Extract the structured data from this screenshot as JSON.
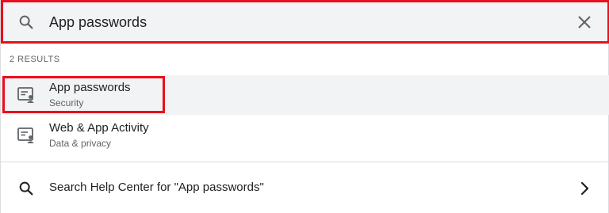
{
  "search": {
    "value": "App passwords",
    "search_icon": "search-icon",
    "clear_icon": "close-icon"
  },
  "results": {
    "count_label": "2 RESULTS",
    "items": [
      {
        "title": "App passwords",
        "subtitle": "Security",
        "icon": "account-settings-icon"
      },
      {
        "title": "Web & App Activity",
        "subtitle": "Data & privacy",
        "icon": "account-settings-icon"
      }
    ]
  },
  "help": {
    "label": "Search Help Center for \"App passwords\"",
    "icon": "search-icon",
    "chevron": "chevron-right-icon"
  },
  "colors": {
    "highlight": "#e8101c",
    "bar_bg": "#f1f3f4",
    "text": "#202124",
    "muted": "#5f6368"
  }
}
